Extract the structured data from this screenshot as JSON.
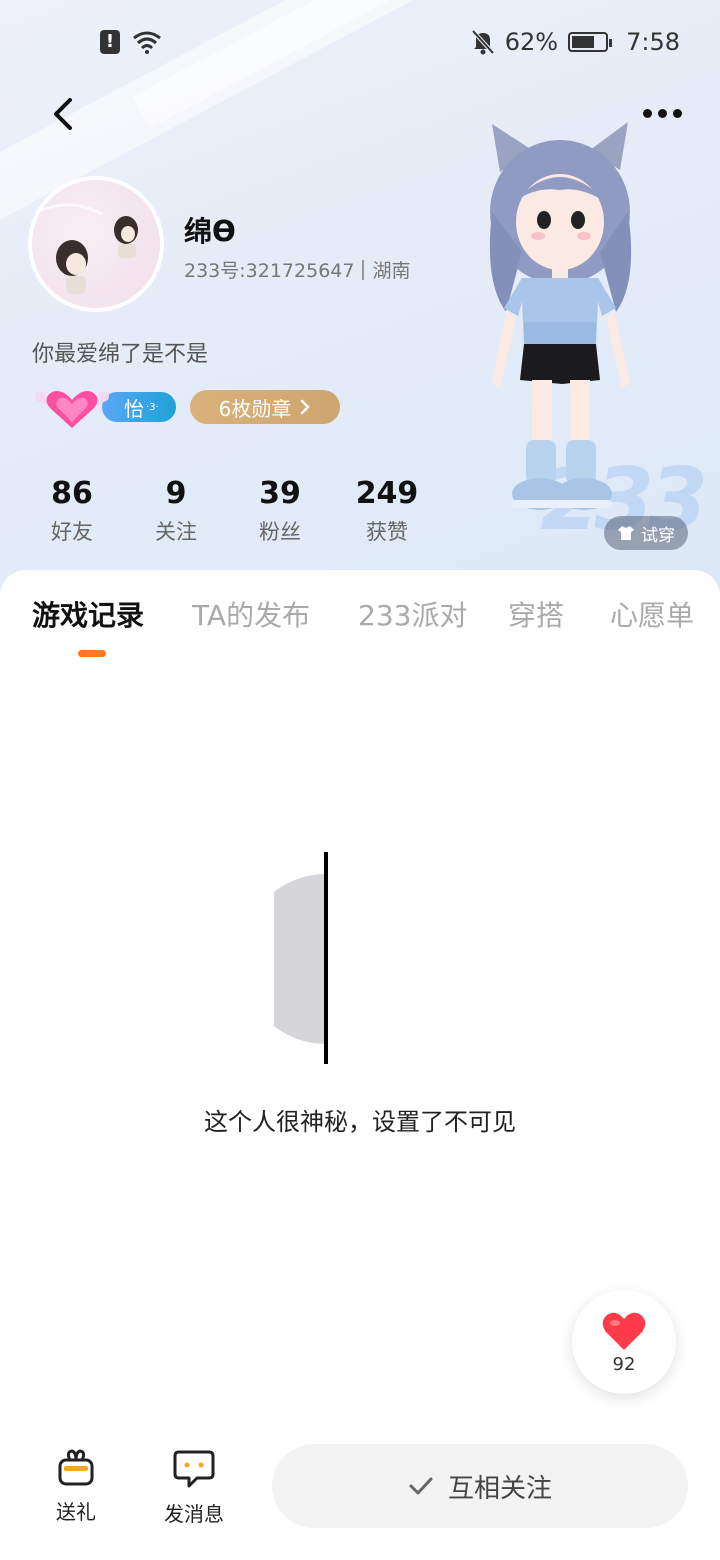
{
  "status_bar": {
    "battery_pct": "62%",
    "time": "7:58",
    "icons": [
      "alert-icon",
      "wifi-icon",
      "mute-bell-icon",
      "battery-charging-icon"
    ]
  },
  "profile": {
    "username": "绵ϴ",
    "id_text": "233号:321725647",
    "location": "湖南",
    "bio": "你最爱绵了是不是",
    "level_name": "怡",
    "level_sup": "·3·",
    "medals_label": "6枚勋章",
    "try_on_label": "试穿",
    "bg_logo": "233"
  },
  "stats": [
    {
      "value": "86",
      "label": "好友"
    },
    {
      "value": "9",
      "label": "关注"
    },
    {
      "value": "39",
      "label": "粉丝"
    },
    {
      "value": "249",
      "label": "获赞"
    }
  ],
  "tabs": [
    {
      "label": "游戏记录",
      "active": true
    },
    {
      "label": "TA的发布",
      "active": false
    },
    {
      "label": "233派对",
      "active": false
    },
    {
      "label": "穿搭",
      "active": false
    },
    {
      "label": "心愿单",
      "active": false
    }
  ],
  "empty_state": {
    "text": "这个人很神秘，设置了不可见"
  },
  "like_float": {
    "count": "92"
  },
  "bottom_bar": {
    "gift_label": "送礼",
    "message_label": "发消息",
    "follow_label": "互相关注"
  },
  "colors": {
    "accent": "#ff7a1f",
    "heart": "#ff3b4a",
    "medal": "#cda56e",
    "level": "#1ea2d6"
  }
}
